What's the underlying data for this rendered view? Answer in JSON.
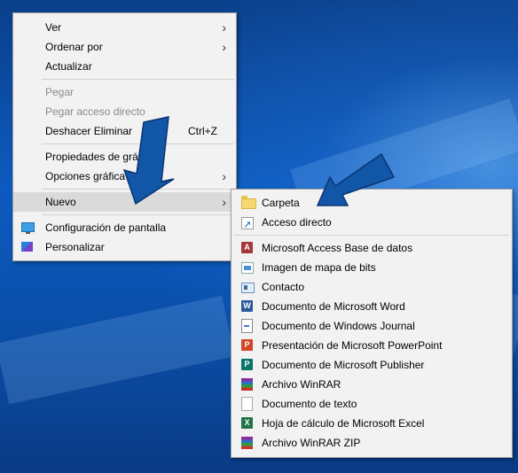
{
  "desktop_menu": {
    "items": [
      {
        "label": "Ver",
        "has_submenu": true
      },
      {
        "label": "Ordenar por",
        "has_submenu": true
      },
      {
        "label": "Actualizar"
      },
      {
        "label": "Pegar",
        "disabled": true
      },
      {
        "label": "Pegar acceso directo",
        "disabled": true
      },
      {
        "label": "Deshacer Eliminar",
        "shortcut": "Ctrl+Z"
      },
      {
        "label": "Propiedades de gráficos...",
        "visible_label": "Propiedades de grá"
      },
      {
        "label": "Opciones gráficas",
        "visible_label": "Opciones gráfica",
        "has_submenu": true
      },
      {
        "label": "Nuevo",
        "has_submenu": true,
        "highlighted": true
      },
      {
        "label": "Configuración de pantalla",
        "icon": "display-settings-icon"
      },
      {
        "label": "Personalizar",
        "icon": "personalize-icon"
      }
    ],
    "labels": {
      "ver": "Ver",
      "ordenar": "Ordenar por",
      "actualizar": "Actualizar",
      "pegar": "Pegar",
      "pegar_acceso": "Pegar acceso directo",
      "deshacer": "Deshacer Eliminar",
      "deshacer_shortcut": "Ctrl+Z",
      "propiedades": "Propiedades de grá",
      "opciones": "Opciones gráfica",
      "nuevo": "Nuevo",
      "config_pantalla": "Configuración de pantalla",
      "personalizar": "Personalizar"
    }
  },
  "new_submenu": {
    "labels": {
      "carpeta": "Carpeta",
      "acceso_directo": "Acceso directo",
      "access": "Microsoft Access Base de datos",
      "bitmap": "Imagen de mapa de bits",
      "contacto": "Contacto",
      "word": "Documento de Microsoft Word",
      "journal": "Documento de Windows Journal",
      "powerpoint": "Presentación de Microsoft PowerPoint",
      "publisher": "Documento de Microsoft Publisher",
      "winrar": "Archivo WinRAR",
      "texto": "Documento de texto",
      "excel": "Hoja de cálculo de Microsoft Excel",
      "winrar_zip": "Archivo WinRAR ZIP"
    },
    "icon_letters": {
      "access": "A",
      "word": "W",
      "powerpoint": "P",
      "publisher": "P",
      "excel": "X"
    }
  },
  "colors": {
    "menu_bg": "#f2f2f2",
    "highlight": "#dadada",
    "disabled_text": "#8a8a8a",
    "arrow_fill": "#1256a8",
    "desktop_bg": "#0b4f9c"
  }
}
